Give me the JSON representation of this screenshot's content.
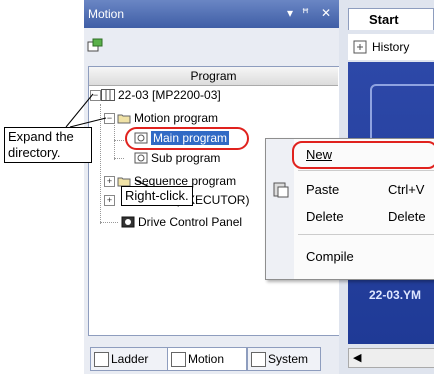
{
  "motion_pane": {
    "title": "Motion",
    "controls": [
      "▾",
      "ꟸ",
      "✕"
    ],
    "column_header": "Program",
    "tree": [
      {
        "label": "22-03 [MP2200-03]"
      },
      {
        "label": "Motion program"
      },
      {
        "label": "Main program"
      },
      {
        "label": "Sub program"
      },
      {
        "label": "Sequence program"
      },
      {
        "label": "(EXECUTOR)"
      },
      {
        "label": "Drive Control Panel"
      }
    ],
    "tabs": [
      {
        "label": "Ladder"
      },
      {
        "label": "Motion"
      },
      {
        "label": "System"
      }
    ]
  },
  "doc_pane": {
    "tab_label": "Start",
    "history_label": "History",
    "panel_text": "22-03.YM"
  },
  "context_menu": {
    "items": [
      {
        "label": "New",
        "shortcut": ""
      },
      {
        "label": "Paste",
        "shortcut": "Ctrl+V"
      },
      {
        "label": "Delete",
        "shortcut": "Delete"
      },
      {
        "label": "Compile",
        "shortcut": ""
      }
    ]
  },
  "callouts": {
    "expand": "Expand the directory.",
    "right_click": "Right-click."
  },
  "colors": {
    "title_bar": "#3f5ea6",
    "selection": "#316ac5",
    "highlight_ring": "#e0221e",
    "doc_panel": "#2d48a8"
  }
}
